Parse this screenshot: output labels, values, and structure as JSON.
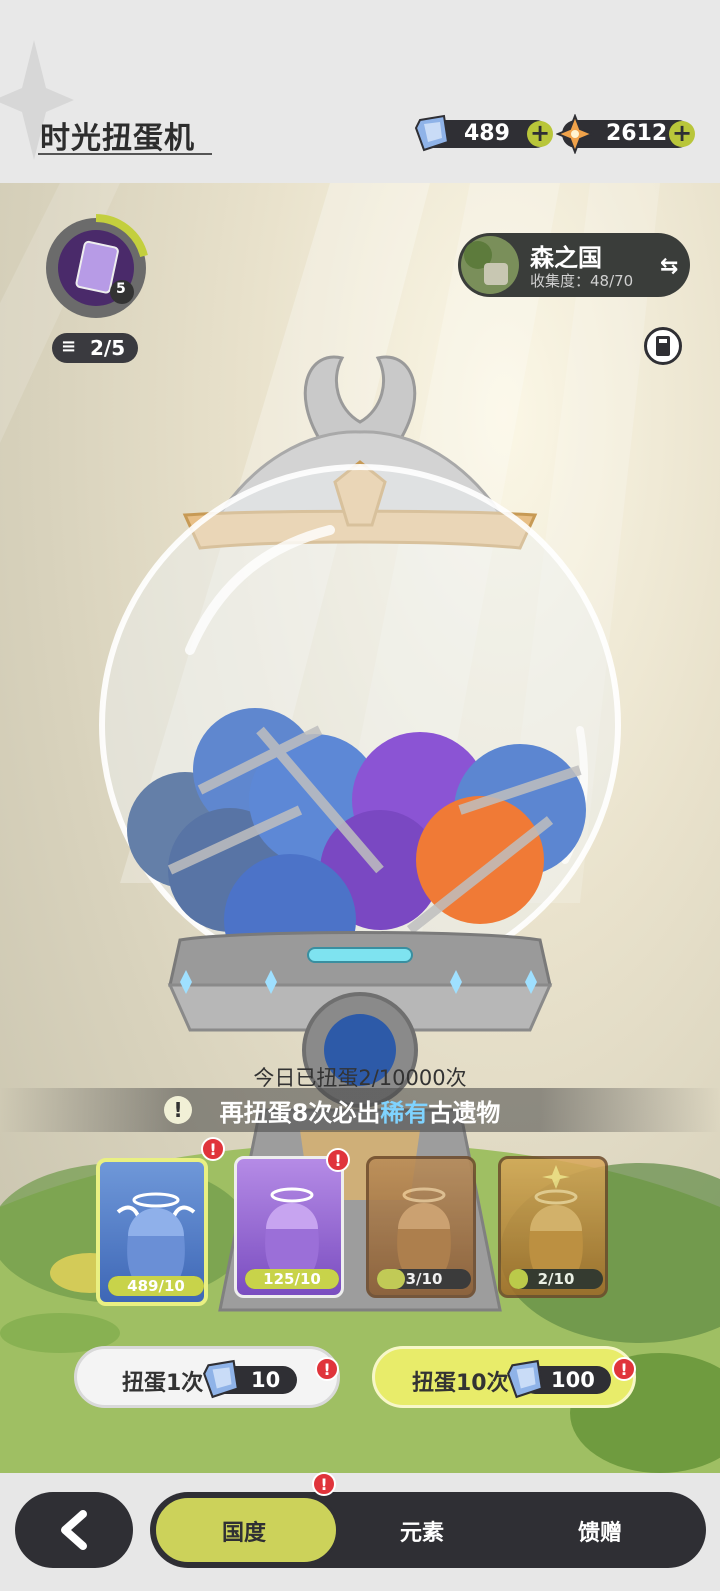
{
  "header": {
    "title": "时光扭蛋机"
  },
  "currency": [
    {
      "name": "crystal",
      "value": "489",
      "icon": "blue-crystal-icon"
    },
    {
      "name": "star-gem",
      "value": "2612",
      "icon": "orange-gem-icon"
    }
  ],
  "relic": {
    "level": "5",
    "progress": "2/5"
  },
  "region": {
    "name": "森之国",
    "collection": "收集度：48/70"
  },
  "machine": {
    "today_text": "今日已扭蛋2/10000次"
  },
  "tip": {
    "pre": "再扭蛋8次必出",
    "rare": "稀有",
    "post": "古遗物"
  },
  "cards": [
    {
      "count": "489/10",
      "fill": 1.0,
      "theme": "blue",
      "alert": "!"
    },
    {
      "count": "125/10",
      "fill": 1.0,
      "theme": "purple",
      "alert": "!"
    },
    {
      "count": "3/10",
      "fill": 0.3,
      "theme": "orange",
      "alert": ""
    },
    {
      "count": "2/10",
      "fill": 0.2,
      "theme": "gold",
      "alert": ""
    }
  ],
  "pull_buttons": [
    {
      "label": "扭蛋1次",
      "cost": "10",
      "alert": "!"
    },
    {
      "label": "扭蛋10次",
      "cost": "100",
      "alert": "!"
    }
  ],
  "nav": {
    "back": "back-arrow-icon",
    "tabs": [
      "国度",
      "元素",
      "馈赠"
    ],
    "active": 0,
    "alert": "!"
  },
  "colors": {
    "accent": "#ccd25a",
    "dark": "#2f2f34",
    "alert": "#e0343b"
  }
}
